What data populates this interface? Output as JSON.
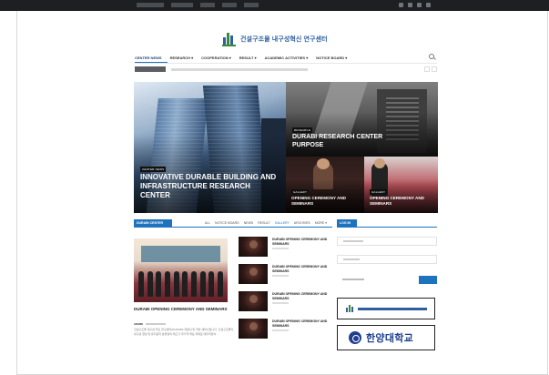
{
  "site": {
    "logo_text": "건설구조물 내구성혁신 연구센터"
  },
  "nav": {
    "items": [
      {
        "label": "CENTER NEWS",
        "active": true
      },
      {
        "label": "RESEARCH ▾",
        "active": false
      },
      {
        "label": "COOPERATION ▾",
        "active": false
      },
      {
        "label": "RESULT ▾",
        "active": false
      },
      {
        "label": "ACADEMIC ACTIVITIES ▾",
        "active": false
      },
      {
        "label": "NOTICE BOARD ▾",
        "active": false
      }
    ]
  },
  "hero": {
    "main": {
      "category": "CENTER NEWS",
      "title": "INNOVATIVE DURABLE BUILDING AND INFRASTRUCTURE RESEARCH CENTER"
    },
    "research": {
      "category": "RESEARCH",
      "title": "DURABI RESEARCH CENTER PURPOSE"
    },
    "gallery1": {
      "category": "GALLERY",
      "title": "OPENING CEREMONY AND SEMINARS"
    },
    "gallery2": {
      "category": "GALLERY",
      "title": "OPENING CEREMONY AND SEMINARS"
    }
  },
  "block": {
    "label": "DURABI CENTER",
    "tabs": [
      {
        "label": "ALL",
        "on": false
      },
      {
        "label": "NOTICE BOARD",
        "on": false
      },
      {
        "label": "NEWS",
        "on": false
      },
      {
        "label": "RESULT",
        "on": false
      },
      {
        "label": "GALLERY",
        "on": true
      },
      {
        "label": "ARCHIVES",
        "on": false
      },
      {
        "label": "MORE ▾",
        "on": false
      }
    ],
    "featured": {
      "title": "DURABI OPENING CEREMONY AND SEMINARS",
      "author": "ADMIN",
      "excerpt": "건설구조물 내구성 혁신 연구센터(DURABI) 개원식 및 학술 세미나입니다. 건설구조물의 내구성 향상 및 유지관리 효율성의 제고가 국가적 핵심 과제로 대두되면서..."
    },
    "list": [
      {
        "title": "DURABI OPENING CEREMONY AND SEMINARS"
      },
      {
        "title": "DURABI OPENING CEREMONY AND SEMINARS"
      },
      {
        "title": "DURABI OPENING CEREMONY AND SEMINARS"
      },
      {
        "title": "DURABI OPENING CEREMONY AND SEMINARS"
      }
    ]
  },
  "login": {
    "label": "LOG IN"
  },
  "banners": {
    "hanyang": "한양대학교"
  }
}
